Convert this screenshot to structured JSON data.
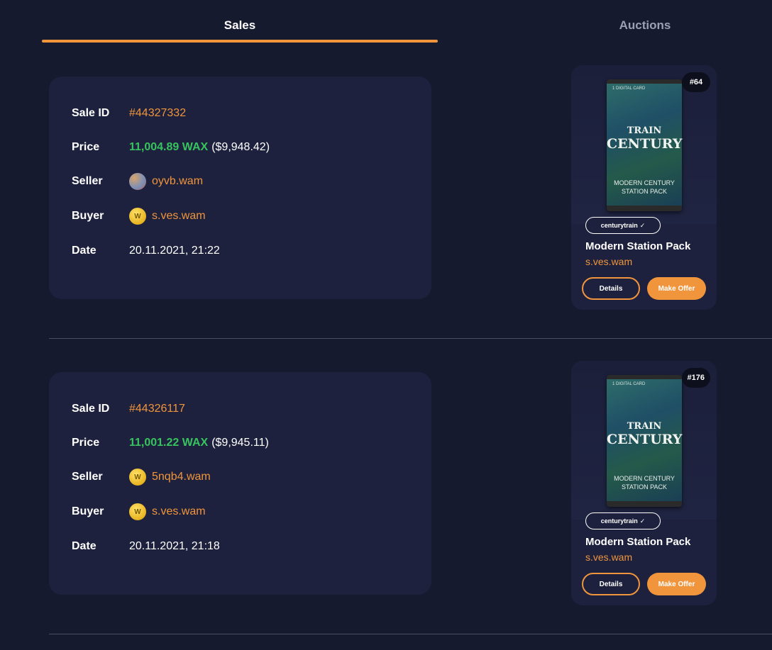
{
  "tabs": {
    "sales": "Sales",
    "auctions": "Auctions"
  },
  "labels": {
    "sale_id": "Sale ID",
    "price": "Price",
    "seller": "Seller",
    "buyer": "Buyer",
    "date": "Date",
    "details": "Details",
    "make_offer": "Make Offer"
  },
  "colors": {
    "accent": "#f0953c",
    "price_green": "#37c35e",
    "background": "#161a2e",
    "card": "#1d213d"
  },
  "sales": [
    {
      "sale_id": "#44327332",
      "price_wax": "11,004.89 WAX",
      "price_usd": "($9,948.42)",
      "seller": "oyvb.wam",
      "seller_avatar": "photo-avatar",
      "buyer": "s.ves.wam",
      "buyer_avatar": "wax-coin-icon",
      "date": "20.11.2021, 21:22",
      "nft": {
        "serial": "#64",
        "pack_top_text": "1 DIGITAL CARD",
        "pack_logo_line1": "TRAIN",
        "pack_logo_line2": "CENTURY",
        "pack_sub_line1": "MODERN CENTURY",
        "pack_sub_line2": "STATION PACK",
        "collection": "centurytrain",
        "name": "Modern Station Pack",
        "owner": "s.ves.wam"
      }
    },
    {
      "sale_id": "#44326117",
      "price_wax": "11,001.22 WAX",
      "price_usd": "($9,945.11)",
      "seller": "5nqb4.wam",
      "seller_avatar": "wax-coin-icon",
      "buyer": "s.ves.wam",
      "buyer_avatar": "wax-coin-icon",
      "date": "20.11.2021, 21:18",
      "nft": {
        "serial": "#176",
        "pack_top_text": "1 DIGITAL CARD",
        "pack_logo_line1": "TRAIN",
        "pack_logo_line2": "CENTURY",
        "pack_sub_line1": "MODERN CENTURY",
        "pack_sub_line2": "STATION PACK",
        "collection": "centurytrain",
        "name": "Modern Station Pack",
        "owner": "s.ves.wam"
      }
    }
  ]
}
